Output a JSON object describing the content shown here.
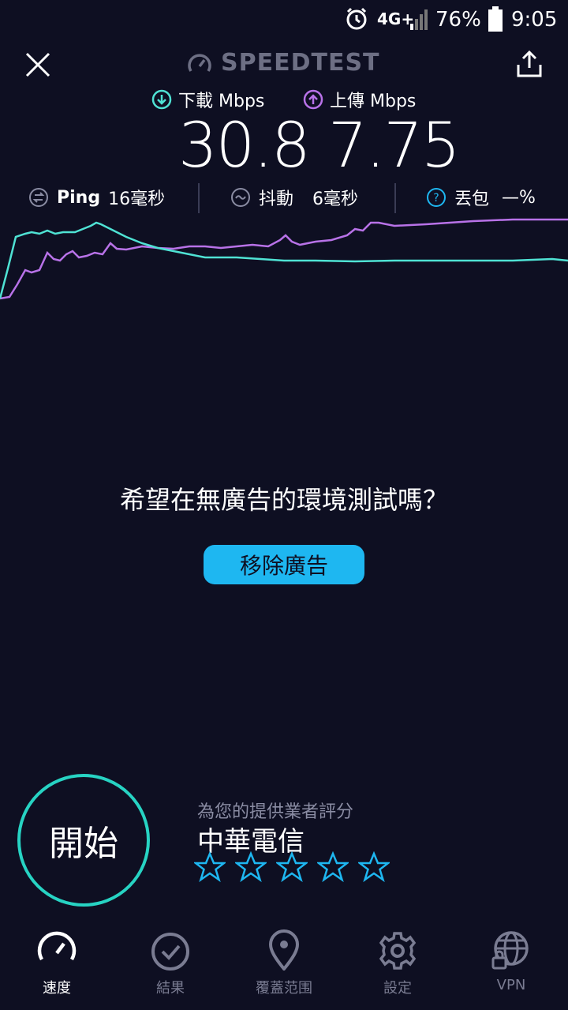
{
  "status_bar": {
    "network": "4G+",
    "battery": "76%",
    "time": "9:05"
  },
  "header": {
    "title": "SPEEDTEST"
  },
  "metrics": {
    "download_label": "下載 Mbps",
    "download_value": "30.8",
    "upload_label": "上傳 Mbps",
    "upload_value": "7.75",
    "ping_label": "Ping",
    "ping_value": "16毫秒",
    "jitter_label": "抖動",
    "jitter_value": "6毫秒",
    "loss_label": "丟包",
    "loss_value": "—%"
  },
  "colors": {
    "background": "#0e0f22",
    "download": "#4fe2d4",
    "upload": "#b872e8",
    "accent_button": "#1eb7f1",
    "go_ring": "#27d3c3"
  },
  "ad": {
    "prompt": "希望在無廣告的環境測試嗎？",
    "button_label": "移除廣告"
  },
  "go": {
    "label": "開始"
  },
  "rating": {
    "label": "為您的提供業者評分",
    "provider": "中華電信",
    "max_stars": 5
  },
  "nav": {
    "items": [
      {
        "label": "速度",
        "icon": "speedometer-icon",
        "active": true
      },
      {
        "label": "結果",
        "icon": "check-circle-icon",
        "active": false
      },
      {
        "label": "覆蓋范围",
        "icon": "map-pin-icon",
        "active": false
      },
      {
        "label": "設定",
        "icon": "gear-icon",
        "active": false
      },
      {
        "label": "VPN",
        "icon": "globe-lock-icon",
        "active": false
      }
    ]
  }
}
